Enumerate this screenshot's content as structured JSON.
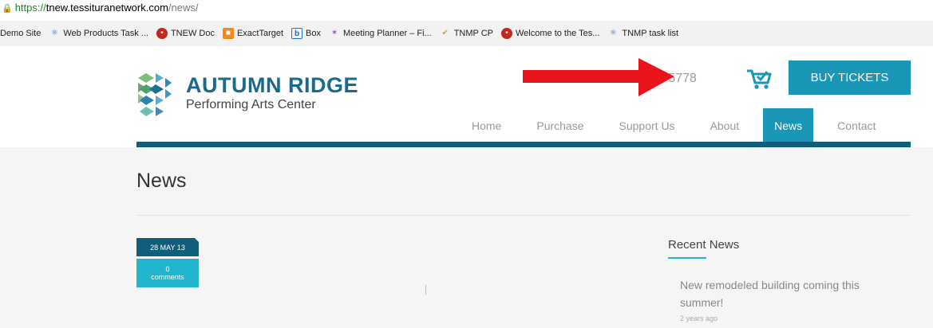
{
  "address_bar": {
    "scheme": "https://",
    "host": "tnew.tessituranetwork.com",
    "path": "/news/"
  },
  "bookmarks": [
    {
      "label": "Demo Site",
      "icon": "none"
    },
    {
      "label": "Web Products Task ...",
      "icon": "tnmp-logo-icon"
    },
    {
      "label": "TNEW Doc",
      "icon": "red-logo-icon"
    },
    {
      "label": "ExactTarget",
      "icon": "exacttarget-icon"
    },
    {
      "label": "Box",
      "icon": "box-icon"
    },
    {
      "label": "Meeting Planner – Fi...",
      "icon": "meeting-planner-icon"
    },
    {
      "label": "TNMP CP",
      "icon": "cp-icon"
    },
    {
      "label": "Welcome to the Tes...",
      "icon": "red-logo-icon"
    },
    {
      "label": "TNMP task list",
      "icon": "tnmp-logo-icon"
    }
  ],
  "header": {
    "logo_name": "AUTUMN RIDGE",
    "logo_sub": "Performing Arts Center",
    "phone": "-643-5778",
    "buy_label": "BUY TICKETS"
  },
  "nav": {
    "items": [
      "Home",
      "Purchase",
      "Support Us",
      "About",
      "News",
      "Contact"
    ],
    "active": "News"
  },
  "main": {
    "title": "News",
    "date_badge": "28 MAY 13",
    "comments_count": "0",
    "comments_label": "comments"
  },
  "sidebar": {
    "title": "Recent News",
    "item_title": "New remodeled building coming this summer!",
    "item_time": "2 years ago"
  },
  "colors": {
    "brand_blue": "#1a96b7",
    "dark_blue": "#115e7a",
    "arrow_red": "#e8131b"
  }
}
